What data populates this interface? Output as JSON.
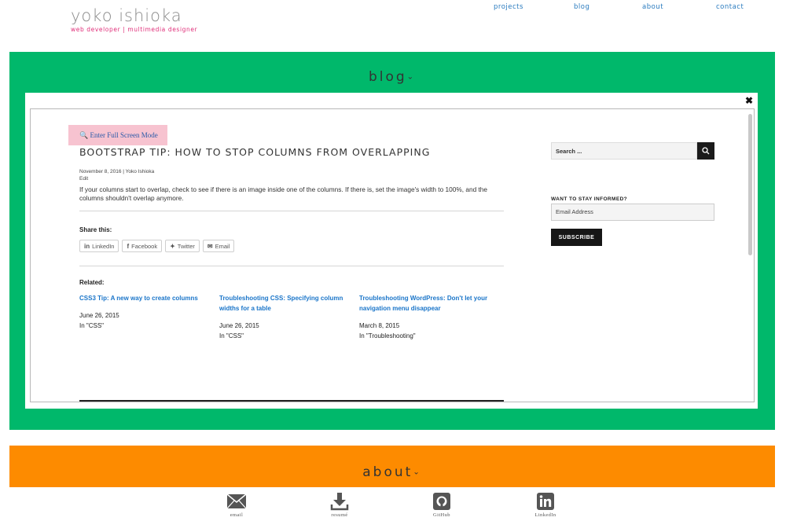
{
  "header": {
    "logo_name": "yoko ishioka",
    "logo_tagline": "web developer | multimedia designer",
    "nav": [
      "projects",
      "blog",
      "about",
      "contact"
    ]
  },
  "blog_section": {
    "title": "blog",
    "chevron": "⌄",
    "close_label": "✖",
    "fullscreen_label": "Enter Full Screen Mode",
    "post": {
      "title": "BOOTSTRAP TIP: HOW TO STOP COLUMNS FROM OVERLAPPING",
      "meta": "November 8, 2016 | Yoko Ishioka",
      "edit": "Edit",
      "body": "If your columns start to overlap, check to see if there is an image inside one of the columns. If there is, set the image's width to 100%, and the columns shouldn't overlap anymore."
    },
    "share": {
      "label": "Share this:",
      "buttons": [
        {
          "label": "LinkedIn",
          "icon": "linkedin-icon"
        },
        {
          "label": "Facebook",
          "icon": "facebook-icon"
        },
        {
          "label": "Twitter",
          "icon": "twitter-icon"
        },
        {
          "label": "Email",
          "icon": "email-icon"
        }
      ]
    },
    "related": {
      "label": "Related:",
      "items": [
        {
          "title": "CSS3 Tip: A new way to create columns",
          "date": "June 26, 2015",
          "category": "In \"CSS\""
        },
        {
          "title": "Troubleshooting CSS: Specifying column widths for a table",
          "date": "June 26, 2015",
          "category": "In \"CSS\""
        },
        {
          "title": "Troubleshooting WordPress: Don't let your navigation menu disappear",
          "date": "March 8, 2015",
          "category": "In \"Troubleshooting\""
        }
      ]
    },
    "sidebar": {
      "search_placeholder": "Search ...",
      "stay_informed_label": "WANT TO STAY INFORMED?",
      "email_placeholder": "Email Address",
      "subscribe_label": "SUBSCRIBE"
    }
  },
  "about_section": {
    "title": "about",
    "chevron": "⌄"
  },
  "footer": {
    "links": [
      {
        "label": "email",
        "icon": "envelope-icon"
      },
      {
        "label": "resumé",
        "icon": "download-icon"
      },
      {
        "label": "GitHub",
        "icon": "github-icon"
      },
      {
        "label": "LinkedIn",
        "icon": "linkedin-icon"
      }
    ]
  },
  "colors": {
    "blog_bg": "#00b86b",
    "about_bg": "#fd8b00",
    "link": "#1a75c9",
    "accent_pink": "#e0307a"
  }
}
